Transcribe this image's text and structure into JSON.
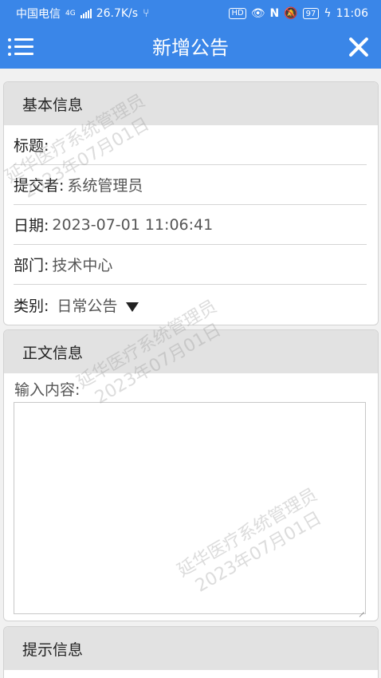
{
  "status_bar": {
    "carrier": "中国电信",
    "network": "4G",
    "speed": "26.7K/s",
    "battery": "97",
    "time": "11:06"
  },
  "header": {
    "title": "新增公告"
  },
  "basic_info": {
    "title": "基本信息",
    "fields": [
      {
        "label": "标题:",
        "value": ""
      },
      {
        "label": "提交者:",
        "value": "系统管理员"
      },
      {
        "label": "日期:",
        "value": "2023-07-01 11:06:41"
      },
      {
        "label": "部门:",
        "value": "技术中心"
      }
    ],
    "category": {
      "label": "类别:",
      "value": "日常公告"
    }
  },
  "body_info": {
    "title": "正文信息",
    "content_label": "输入内容:",
    "content_value": ""
  },
  "hint_info": {
    "title": "提示信息"
  },
  "watermark": {
    "line1": "延华医疗系统管理员",
    "line2": "2023年07月01日"
  }
}
